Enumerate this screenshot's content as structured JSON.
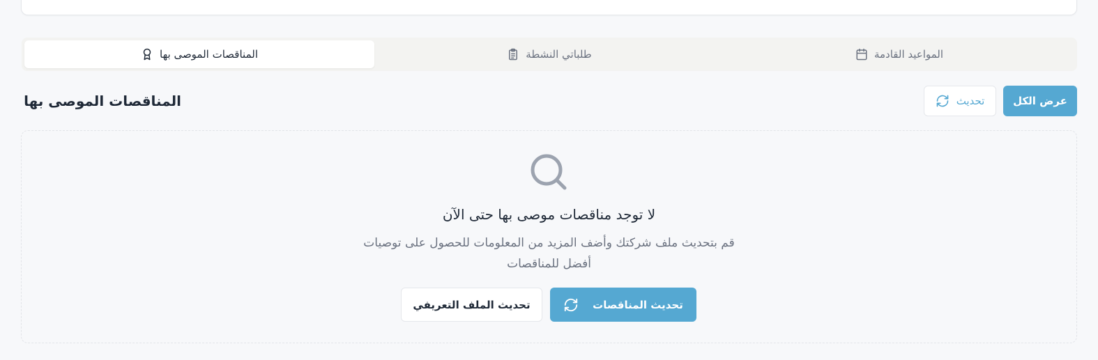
{
  "tabs": [
    {
      "label": "المواعيد القادمة",
      "icon": "calendar-icon",
      "active": false
    },
    {
      "label": "طلباتي النشطة",
      "icon": "clipboard-icon",
      "active": false
    },
    {
      "label": "المناقصات الموصى بها",
      "icon": "award-icon",
      "active": true
    }
  ],
  "section": {
    "title": "المناقصات الموصى بها",
    "view_all_label": "عرض الكل",
    "refresh_label": "تحديث"
  },
  "empty_state": {
    "icon": "search-icon",
    "title": "لا توجد مناقصات موصى بها حتى الآن",
    "description": "قم بتحديث ملف شركتك وأضف المزيد من المعلومات للحصول على توصيات أفضل للمناقصات",
    "update_tenders_label": "تحديث المناقصات",
    "update_profile_label": "تحديث الملف التعريفي"
  },
  "colors": {
    "accent": "#55a8d2",
    "background": "#f7f8fa",
    "tab_bar": "#f3f3f1",
    "muted_text": "#6b7280",
    "icon_gray": "#9ca3af"
  }
}
